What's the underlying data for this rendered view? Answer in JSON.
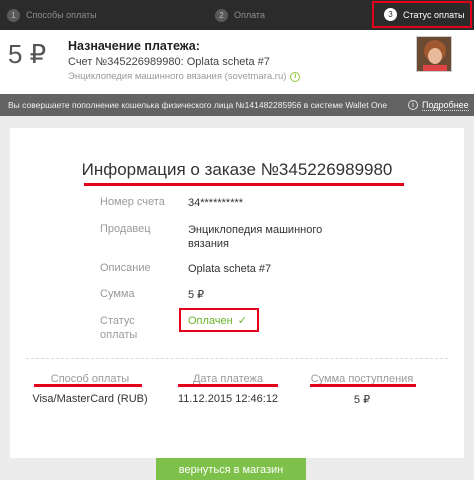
{
  "steps": [
    {
      "num": "1",
      "label": "Способы оплаты"
    },
    {
      "num": "2",
      "label": "Оплата"
    },
    {
      "num": "3",
      "label": "Статус оплаты"
    }
  ],
  "header": {
    "amount": "5 ₽",
    "title": "Назначение платежа:",
    "line": "Счет №345226989980: Oplata scheta #7",
    "site": "Энциклопедия машинного вязания (sovetmara.ru)"
  },
  "banner": {
    "text": "Вы совершаете пополнение кошелька физического лица №141482285956 в системе Wallet One",
    "more": "Подробнее"
  },
  "order": {
    "title": "Информация о заказе №345226989980",
    "rows": [
      {
        "label": "Номер счета",
        "value": "34**********"
      },
      {
        "label": "Продавец",
        "value": "Энциклопедия машинного вязания"
      },
      {
        "label": "Описание",
        "value": "Oplata scheta #7"
      },
      {
        "label": "Сумма",
        "value": "5 ₽"
      },
      {
        "label": "Статус оплаты",
        "value": "Оплачен"
      }
    ],
    "columns": [
      {
        "header": "Способ оплаты",
        "value": "Visa/MasterCard (RUB)"
      },
      {
        "header": "Дата платежа",
        "value": "11.12.2015 12:46:12"
      },
      {
        "header": "Сумма поступления",
        "value": "5 ₽"
      }
    ]
  },
  "actions": {
    "return_label": "вернуться в магазин"
  },
  "colors": {
    "accent_red": "#e2001a",
    "success_green": "#6ab42d",
    "button_green": "#7ec14a",
    "steps_bg": "#2b2b2b",
    "banner_bg": "#636363"
  }
}
